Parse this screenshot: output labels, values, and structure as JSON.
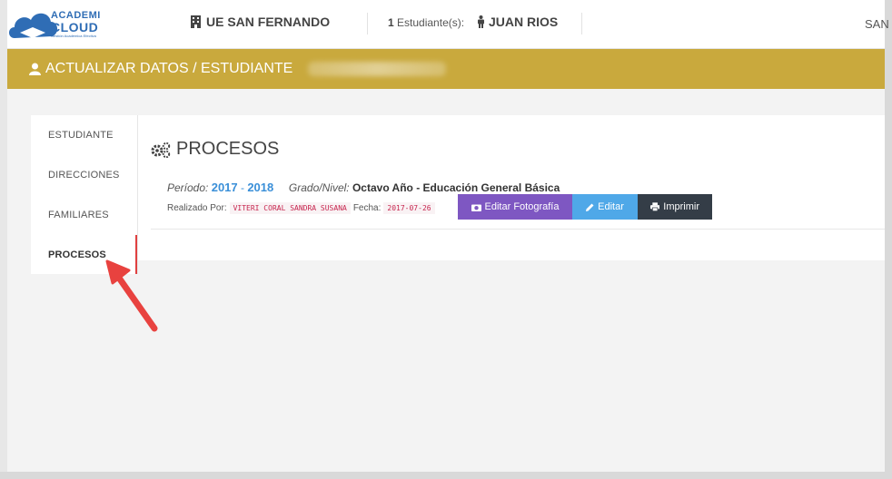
{
  "navbar": {
    "logo": {
      "line1": "ACADEMI",
      "line2": "CLOUD",
      "line3": "Gestión Académica Efectiva"
    },
    "school": "UE SAN FERNANDO",
    "students_count": "1",
    "students_label": "Estudiante(s):",
    "student_name": "JUAN RIOS",
    "right_text": "SAN"
  },
  "titlebar": {
    "title": "ACTUALIZAR DATOS / ESTUDIANTE"
  },
  "sidemenu": {
    "items": [
      {
        "label": "ESTUDIANTE"
      },
      {
        "label": "DIRECCIONES"
      },
      {
        "label": "FAMILIARES"
      },
      {
        "label": "PROCESOS"
      }
    ]
  },
  "content": {
    "heading": "PROCESOS",
    "periodo_label": "Período:",
    "year_start": "2017",
    "year_sep": "-",
    "year_end": "2018",
    "grado_label": "Grado/Nivel:",
    "grado_value": "Octavo Año - Educación General Básica",
    "realizado_label": "Realizado Por:",
    "realizado_value": "VITERI CORAL SANDRA SUSANA",
    "fecha_label": "Fecha:",
    "fecha_value": "2017-07-26",
    "buttons": {
      "photo": "Editar Fotografía",
      "edit": "Editar",
      "print": "Imprimir"
    }
  },
  "colors": {
    "titlebar": "#c9a93d",
    "photo_button": "#7e57c2",
    "edit_button": "#4fa8e8",
    "print_button": "#343d47",
    "active_marker": "#e04040",
    "arrow": "#e8423f"
  }
}
